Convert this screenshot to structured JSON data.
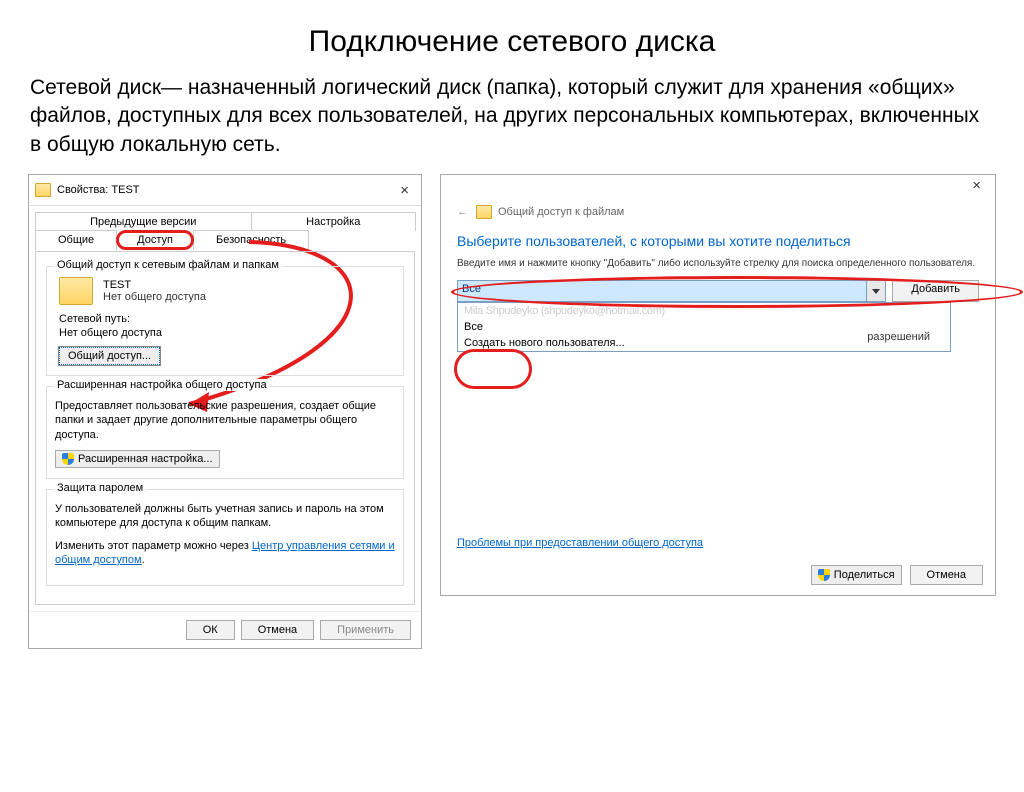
{
  "page": {
    "title": "Подключение сетевого диска",
    "description": "Сетевой диск— назначенный логический диск (папка), который служит для хранения «общих» файлов, доступных для всех пользователей, на других персональных компьютерах, включенных в общую локальную сеть."
  },
  "props_dialog": {
    "title": "Свойства: TEST",
    "tabs_top": {
      "prev": "Предыдущие версии",
      "settings": "Настройка"
    },
    "tabs_bottom": {
      "general": "Общие",
      "access": "Доступ",
      "security": "Безопасность"
    },
    "group1": {
      "title": "Общий доступ к сетевым файлам и папкам",
      "folder_name": "TEST",
      "folder_share": "Нет общего доступа",
      "net_path_label": "Сетевой путь:",
      "net_path_value": "Нет общего доступа",
      "share_btn": "Общий доступ..."
    },
    "group2": {
      "title": "Расширенная настройка общего доступа",
      "text": "Предоставляет пользовательские разрешения, создает общие папки и задает другие дополнительные параметры общего доступа.",
      "btn": "Расширенная настройка..."
    },
    "group3": {
      "title": "Защита паролем",
      "text": "У пользователей должны быть учетная запись и пароль на этом компьютере для доступа к общим папкам.",
      "text2_prefix": "Изменить этот параметр можно через ",
      "link": "Центр управления сетями и общим доступом",
      "text2_suffix": "."
    },
    "buttons": {
      "ok": "ОК",
      "cancel": "Отмена",
      "apply": "Применить"
    }
  },
  "share_dialog": {
    "header": "Общий доступ к файлам",
    "heading": "Выберите пользователей, с которыми вы хотите поделиться",
    "sub": "Введите имя и нажмите кнопку \"Добавить\" либо используйте стрелку для поиска определенного пользователя.",
    "combo_value": "Все",
    "add_btn": "Добавить",
    "options": {
      "opt1": "Mila Shpudeyko (shpudeyko@hotmail.com)",
      "opt2": "Все",
      "opt3": "Создать нового пользователя..."
    },
    "perm_col": "разрешений",
    "trouble_link": "Проблемы при предоставлении общего доступа",
    "share_btn": "Поделиться",
    "cancel_btn": "Отмена"
  }
}
